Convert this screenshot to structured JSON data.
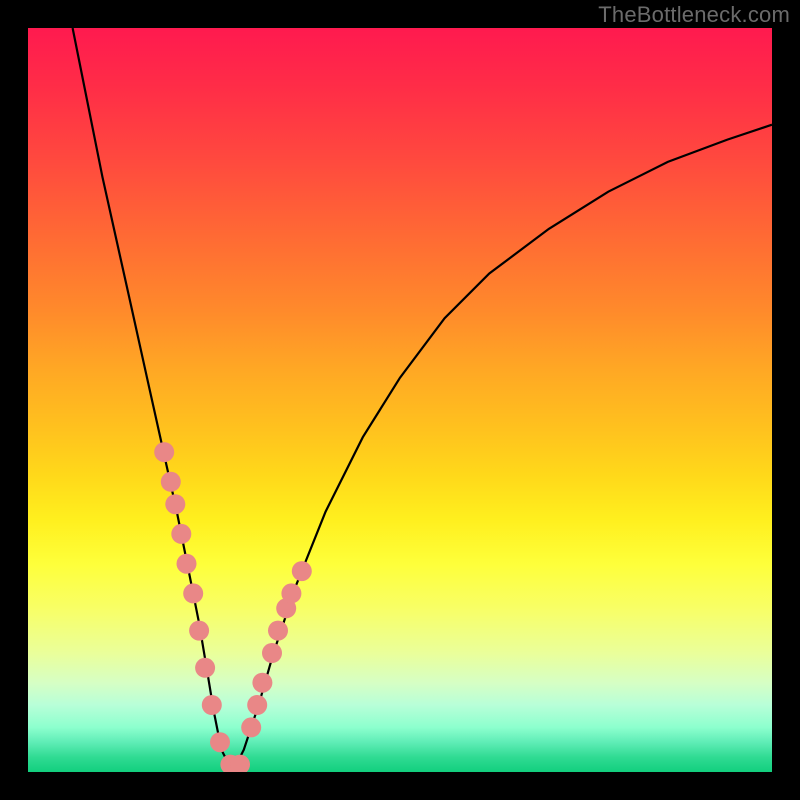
{
  "watermark": "TheBottleneck.com",
  "chart_data": {
    "type": "line",
    "title": "",
    "xlabel": "",
    "ylabel": "",
    "xlim": [
      0,
      100
    ],
    "ylim": [
      0,
      100
    ],
    "grid": false,
    "legend": false,
    "curve": {
      "name": "bottleneck-curve",
      "color": "#000000",
      "x": [
        6,
        8,
        10,
        12,
        14,
        16,
        18,
        20,
        22,
        23,
        24,
        25,
        26,
        27,
        28,
        29,
        31,
        33,
        36,
        40,
        45,
        50,
        56,
        62,
        70,
        78,
        86,
        94,
        100
      ],
      "y": [
        100,
        90,
        80,
        71,
        62,
        53,
        44,
        35,
        25,
        20,
        14,
        8,
        3,
        1,
        1,
        3,
        9,
        16,
        25,
        35,
        45,
        53,
        61,
        67,
        73,
        78,
        82,
        85,
        87
      ]
    },
    "markers": {
      "name": "highlight-points",
      "color": "#e98787",
      "radius": 10,
      "x": [
        18.3,
        19.2,
        19.8,
        20.6,
        21.3,
        22.2,
        23.0,
        23.8,
        24.7,
        25.8,
        27.2,
        28.5,
        30.0,
        30.8,
        31.5,
        32.8,
        33.6,
        34.7,
        35.4,
        36.8
      ],
      "y": [
        43,
        39,
        36,
        32,
        28,
        24,
        19,
        14,
        9,
        4,
        1,
        1,
        6,
        9,
        12,
        16,
        19,
        22,
        24,
        27
      ]
    },
    "background_gradient_stops": [
      {
        "pos": 0,
        "color": "#ff1a4f"
      },
      {
        "pos": 50,
        "color": "#ffc21e"
      },
      {
        "pos": 75,
        "color": "#feff3a"
      },
      {
        "pos": 100,
        "color": "#12cf7e"
      }
    ]
  }
}
